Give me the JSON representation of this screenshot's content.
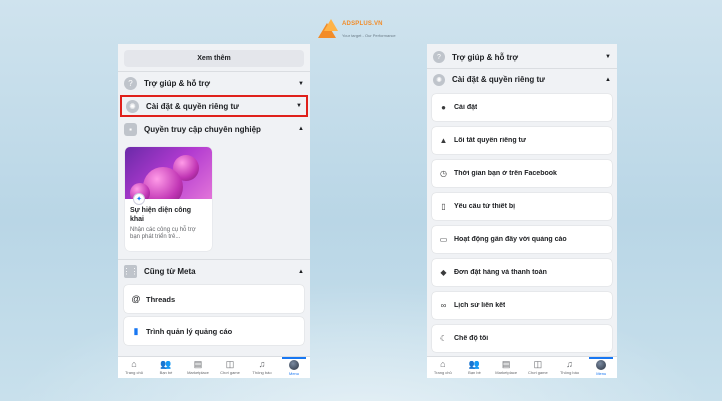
{
  "logo": {
    "name": "ADSPLUS",
    "suffix": ".VN",
    "tagline": "Your target - Our Performance",
    "colors": {
      "primary": "#f28c28",
      "secondary": "#ffb347"
    }
  },
  "left": {
    "see_more": "Xem thêm",
    "help": {
      "label": "Trợ giúp & hỗ trợ",
      "icon": "question-icon"
    },
    "settings": {
      "label": "Cài đặt & quyền riêng tư",
      "icon": "gear-icon",
      "highlight_color": "#e0201b"
    },
    "pro_access": {
      "label": "Quyền truy cập chuyên nghiệp",
      "icon": "briefcase-icon"
    },
    "pro_card": {
      "title": "Sự hiện diện công khai",
      "desc": "Nhận các công cụ hỗ trợ bạn phát triển trê..."
    },
    "meta": {
      "label": "Cũng từ Meta",
      "icon": "grid-icon"
    },
    "meta_items": [
      {
        "label": "Threads",
        "icon": "threads-icon"
      },
      {
        "label": "Trình quản lý quảng cáo",
        "icon": "ads-manager-icon"
      }
    ]
  },
  "right": {
    "help": {
      "label": "Trợ giúp & hỗ trợ",
      "icon": "question-icon"
    },
    "settings": {
      "label": "Cài đặt & quyền riêng tư",
      "icon": "gear-icon"
    },
    "items": [
      {
        "label": "Cài đặt",
        "icon": "user-settings-icon"
      },
      {
        "label": "Lối tắt quyền riêng tư",
        "icon": "lock-icon"
      },
      {
        "label": "Thời gian bạn ở trên Facebook",
        "icon": "clock-icon"
      },
      {
        "label": "Yêu cầu từ thiết bị",
        "icon": "device-icon"
      },
      {
        "label": "Hoạt động gần đây với quảng cáo",
        "icon": "ad-activity-icon"
      },
      {
        "label": "Đơn đặt hàng và thanh toán",
        "icon": "tag-icon"
      },
      {
        "label": "Lịch sử liên kết",
        "icon": "link-icon"
      },
      {
        "label": "Chế độ tối",
        "icon": "moon-icon"
      }
    ]
  },
  "tabs": [
    {
      "label": "Trang chủ",
      "icon": "home-icon"
    },
    {
      "label": "Bạn bè",
      "icon": "friends-icon"
    },
    {
      "label": "Marketplace",
      "icon": "marketplace-icon"
    },
    {
      "label": "Chơi game",
      "icon": "gaming-icon"
    },
    {
      "label": "Thông báo",
      "icon": "bell-icon"
    },
    {
      "label": "Menu",
      "icon": "avatar-icon"
    }
  ],
  "accent": "#1877f2"
}
